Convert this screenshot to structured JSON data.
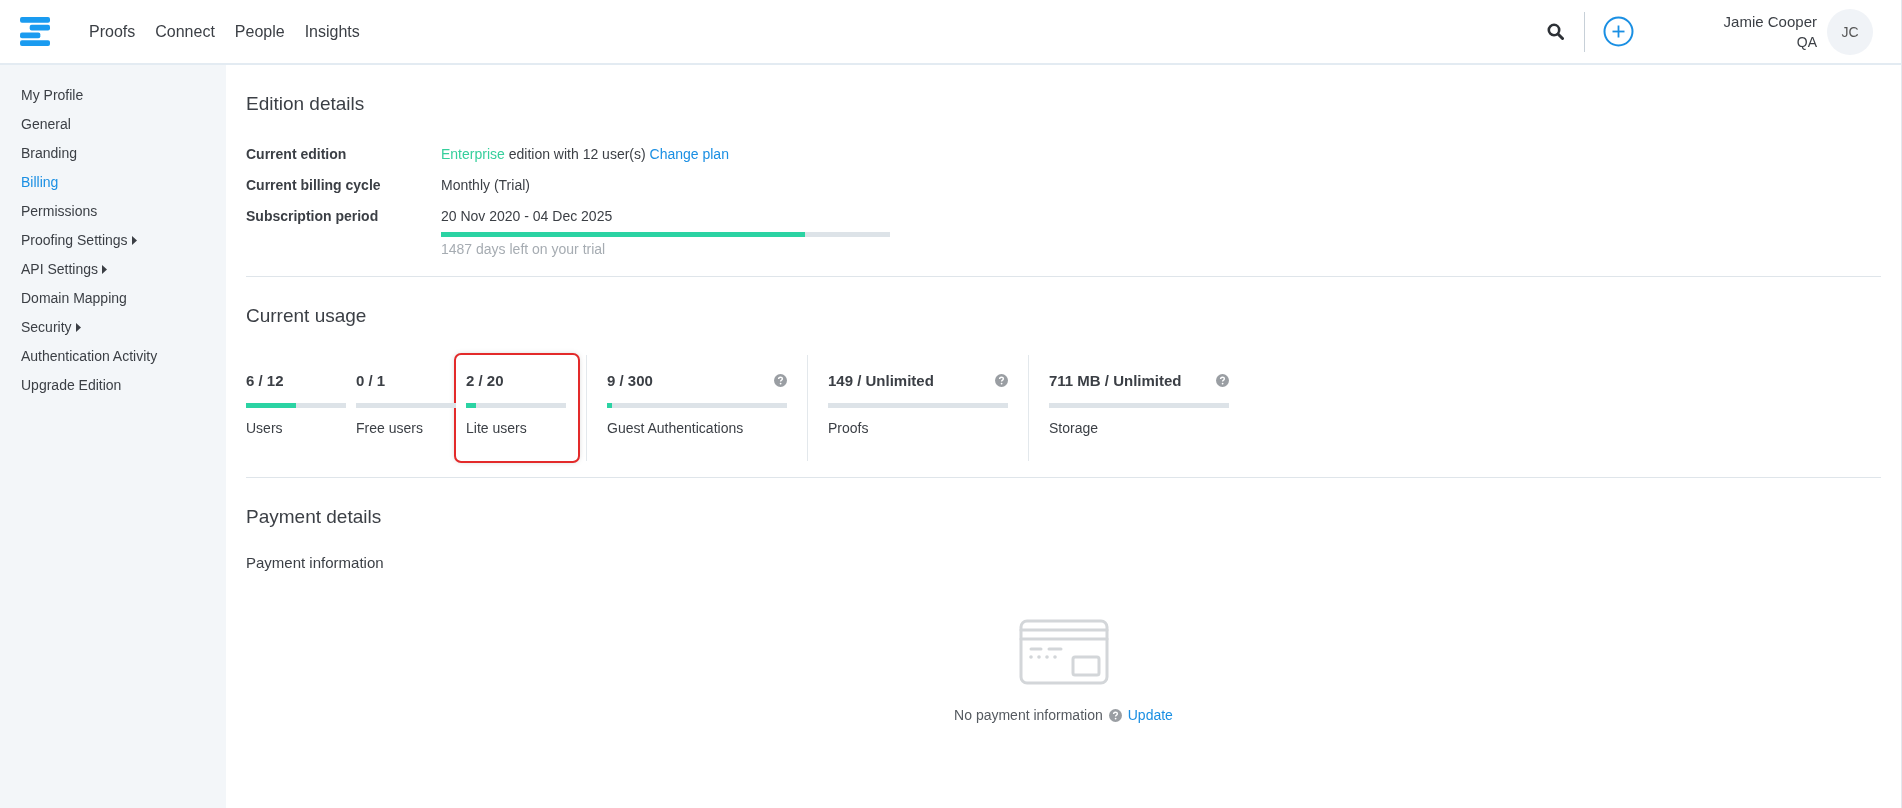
{
  "topnav": {
    "links": [
      {
        "label": "Proofs"
      },
      {
        "label": "Connect"
      },
      {
        "label": "People"
      },
      {
        "label": "Insights"
      }
    ]
  },
  "user": {
    "name": "Jamie Cooper",
    "role": "QA",
    "initials": "JC"
  },
  "sidebar": {
    "items": [
      {
        "label": "My Profile",
        "selected": false,
        "submenu": false
      },
      {
        "label": "General",
        "selected": false,
        "submenu": false
      },
      {
        "label": "Branding",
        "selected": false,
        "submenu": false
      },
      {
        "label": "Billing",
        "selected": true,
        "submenu": false
      },
      {
        "label": "Permissions",
        "selected": false,
        "submenu": false
      },
      {
        "label": "Proofing Settings",
        "selected": false,
        "submenu": true
      },
      {
        "label": "API Settings",
        "selected": false,
        "submenu": true
      },
      {
        "label": "Domain Mapping",
        "selected": false,
        "submenu": false
      },
      {
        "label": "Security",
        "selected": false,
        "submenu": true
      },
      {
        "label": "Authentication Activity",
        "selected": false,
        "submenu": false
      },
      {
        "label": "Upgrade Edition",
        "selected": false,
        "submenu": false
      }
    ]
  },
  "edition_details": {
    "title": "Edition details",
    "rows": [
      {
        "label": "Current edition",
        "edition": "Enterprise",
        "text": "edition with 12 user(s)",
        "link": "Change plan"
      },
      {
        "label": "Current billing cycle",
        "text": "Monthly (Trial)"
      },
      {
        "label": "Subscription period",
        "text": "20 Nov 2020 - 04 Dec 2025"
      }
    ],
    "trial": {
      "level": 0.81,
      "caption": "1487 days left on your trial"
    }
  },
  "current_usage": {
    "title": "Current usage",
    "groups": [
      {
        "items": [
          {
            "value": "6 / 12",
            "label": "Users",
            "level": 0.5,
            "help": false,
            "highlighted": false
          },
          {
            "value": "0 / 1",
            "label": "Free users",
            "level": 0,
            "help": false,
            "highlighted": false
          },
          {
            "value": "2 / 20",
            "label": "Lite users",
            "level": 0.1,
            "help": false,
            "highlighted": true
          }
        ]
      },
      {
        "items": [
          {
            "value": "9 / 300",
            "label": "Guest Authentications",
            "level": 0.03,
            "help": true,
            "highlighted": false
          }
        ]
      },
      {
        "items": [
          {
            "value": "149 / Unlimited",
            "label": "Proofs",
            "level": 0,
            "help": true,
            "highlighted": false
          }
        ]
      },
      {
        "items": [
          {
            "value": "711 MB / Unlimited",
            "label": "Storage",
            "level": 0,
            "help": true,
            "highlighted": false
          }
        ]
      }
    ]
  },
  "payment_details": {
    "title": "Payment details",
    "subtitle": "Payment information",
    "empty_text": "No payment information",
    "link": "Update"
  }
}
